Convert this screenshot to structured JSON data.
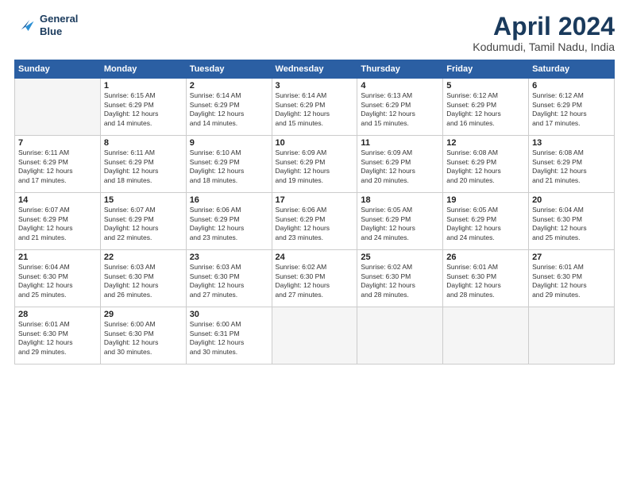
{
  "logo": {
    "line1": "General",
    "line2": "Blue"
  },
  "title": "April 2024",
  "subtitle": "Kodumudi, Tamil Nadu, India",
  "weekdays": [
    "Sunday",
    "Monday",
    "Tuesday",
    "Wednesday",
    "Thursday",
    "Friday",
    "Saturday"
  ],
  "weeks": [
    [
      {
        "day": "",
        "info": ""
      },
      {
        "day": "1",
        "info": "Sunrise: 6:15 AM\nSunset: 6:29 PM\nDaylight: 12 hours\nand 14 minutes."
      },
      {
        "day": "2",
        "info": "Sunrise: 6:14 AM\nSunset: 6:29 PM\nDaylight: 12 hours\nand 14 minutes."
      },
      {
        "day": "3",
        "info": "Sunrise: 6:14 AM\nSunset: 6:29 PM\nDaylight: 12 hours\nand 15 minutes."
      },
      {
        "day": "4",
        "info": "Sunrise: 6:13 AM\nSunset: 6:29 PM\nDaylight: 12 hours\nand 15 minutes."
      },
      {
        "day": "5",
        "info": "Sunrise: 6:12 AM\nSunset: 6:29 PM\nDaylight: 12 hours\nand 16 minutes."
      },
      {
        "day": "6",
        "info": "Sunrise: 6:12 AM\nSunset: 6:29 PM\nDaylight: 12 hours\nand 17 minutes."
      }
    ],
    [
      {
        "day": "7",
        "info": "Sunrise: 6:11 AM\nSunset: 6:29 PM\nDaylight: 12 hours\nand 17 minutes."
      },
      {
        "day": "8",
        "info": "Sunrise: 6:11 AM\nSunset: 6:29 PM\nDaylight: 12 hours\nand 18 minutes."
      },
      {
        "day": "9",
        "info": "Sunrise: 6:10 AM\nSunset: 6:29 PM\nDaylight: 12 hours\nand 18 minutes."
      },
      {
        "day": "10",
        "info": "Sunrise: 6:09 AM\nSunset: 6:29 PM\nDaylight: 12 hours\nand 19 minutes."
      },
      {
        "day": "11",
        "info": "Sunrise: 6:09 AM\nSunset: 6:29 PM\nDaylight: 12 hours\nand 20 minutes."
      },
      {
        "day": "12",
        "info": "Sunrise: 6:08 AM\nSunset: 6:29 PM\nDaylight: 12 hours\nand 20 minutes."
      },
      {
        "day": "13",
        "info": "Sunrise: 6:08 AM\nSunset: 6:29 PM\nDaylight: 12 hours\nand 21 minutes."
      }
    ],
    [
      {
        "day": "14",
        "info": "Sunrise: 6:07 AM\nSunset: 6:29 PM\nDaylight: 12 hours\nand 21 minutes."
      },
      {
        "day": "15",
        "info": "Sunrise: 6:07 AM\nSunset: 6:29 PM\nDaylight: 12 hours\nand 22 minutes."
      },
      {
        "day": "16",
        "info": "Sunrise: 6:06 AM\nSunset: 6:29 PM\nDaylight: 12 hours\nand 23 minutes."
      },
      {
        "day": "17",
        "info": "Sunrise: 6:06 AM\nSunset: 6:29 PM\nDaylight: 12 hours\nand 23 minutes."
      },
      {
        "day": "18",
        "info": "Sunrise: 6:05 AM\nSunset: 6:29 PM\nDaylight: 12 hours\nand 24 minutes."
      },
      {
        "day": "19",
        "info": "Sunrise: 6:05 AM\nSunset: 6:29 PM\nDaylight: 12 hours\nand 24 minutes."
      },
      {
        "day": "20",
        "info": "Sunrise: 6:04 AM\nSunset: 6:30 PM\nDaylight: 12 hours\nand 25 minutes."
      }
    ],
    [
      {
        "day": "21",
        "info": "Sunrise: 6:04 AM\nSunset: 6:30 PM\nDaylight: 12 hours\nand 25 minutes."
      },
      {
        "day": "22",
        "info": "Sunrise: 6:03 AM\nSunset: 6:30 PM\nDaylight: 12 hours\nand 26 minutes."
      },
      {
        "day": "23",
        "info": "Sunrise: 6:03 AM\nSunset: 6:30 PM\nDaylight: 12 hours\nand 27 minutes."
      },
      {
        "day": "24",
        "info": "Sunrise: 6:02 AM\nSunset: 6:30 PM\nDaylight: 12 hours\nand 27 minutes."
      },
      {
        "day": "25",
        "info": "Sunrise: 6:02 AM\nSunset: 6:30 PM\nDaylight: 12 hours\nand 28 minutes."
      },
      {
        "day": "26",
        "info": "Sunrise: 6:01 AM\nSunset: 6:30 PM\nDaylight: 12 hours\nand 28 minutes."
      },
      {
        "day": "27",
        "info": "Sunrise: 6:01 AM\nSunset: 6:30 PM\nDaylight: 12 hours\nand 29 minutes."
      }
    ],
    [
      {
        "day": "28",
        "info": "Sunrise: 6:01 AM\nSunset: 6:30 PM\nDaylight: 12 hours\nand 29 minutes."
      },
      {
        "day": "29",
        "info": "Sunrise: 6:00 AM\nSunset: 6:30 PM\nDaylight: 12 hours\nand 30 minutes."
      },
      {
        "day": "30",
        "info": "Sunrise: 6:00 AM\nSunset: 6:31 PM\nDaylight: 12 hours\nand 30 minutes."
      },
      {
        "day": "",
        "info": ""
      },
      {
        "day": "",
        "info": ""
      },
      {
        "day": "",
        "info": ""
      },
      {
        "day": "",
        "info": ""
      }
    ]
  ]
}
